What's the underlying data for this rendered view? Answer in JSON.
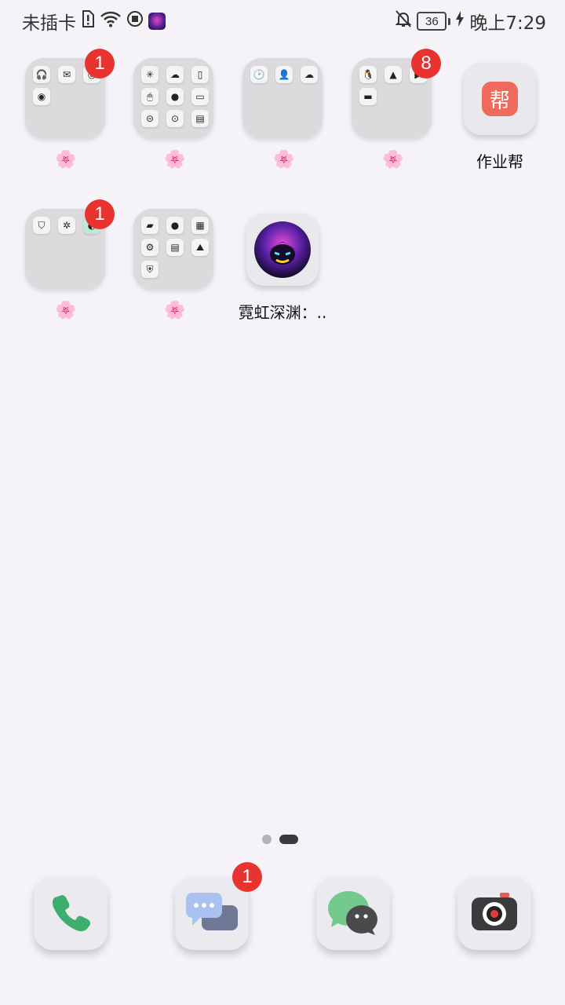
{
  "status_bar": {
    "carrier": "未插卡",
    "battery": "36",
    "time": "晚上7:29"
  },
  "badges": {
    "folder1": "1",
    "folder4": "8",
    "folder5": "1",
    "messages": "1"
  },
  "apps": {
    "folder_label_glyph": "🌸",
    "zuoyebang": {
      "label": "作业帮",
      "icon_char": "帮"
    },
    "neon_abyss": {
      "label": "霓虹深渊：.."
    }
  },
  "page_indicator": {
    "count": 2,
    "active": 2
  },
  "colors": {
    "badge": "#e8332f",
    "phone_green": "#3dae6e",
    "wechat_green": "#74c98c"
  }
}
